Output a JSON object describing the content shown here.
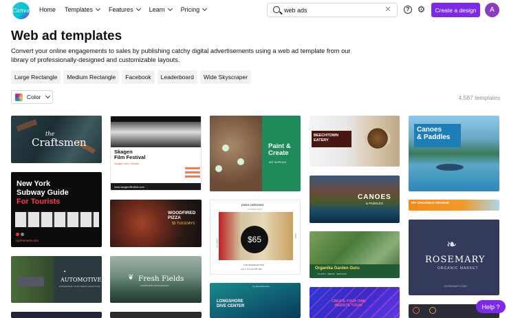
{
  "nav": {
    "logo_text": "Canva",
    "links": [
      "Home",
      "Templates",
      "Features",
      "Learn",
      "Pricing"
    ],
    "search_value": "web ads",
    "create_label": "Create a design",
    "avatar_initial": "A",
    "help_symbol": "?"
  },
  "header": {
    "title": "Web ad templates",
    "description": "Convert your online engagements to sales by publishing catchy digital advertisements using a web ad template from our library of professionally-designed and customizable layouts."
  },
  "chips": [
    "Large Rectangle",
    "Medium Rectangle",
    "Facebook",
    "Leaderboard",
    "Wide Skyscraper"
  ],
  "filter": {
    "color_label": "Color"
  },
  "template_count": "4,587 templates",
  "templates": {
    "craftsmen": {
      "line1": "the",
      "line2": "Craftsmen"
    },
    "skagen": {
      "title": "Skagen\nFilm Festival",
      "sub": "Skagen Arts Theatre",
      "url": "www.skagenfilmfest.com"
    },
    "paint": {
      "title": "Paint &\nCreate",
      "sub": "ART SUPPLIES"
    },
    "beechtown": {
      "title": "BEECHTOWN\nEATERY"
    },
    "canoes_paddles": {
      "title": "Canoes\n& Paddles"
    },
    "nyc": {
      "line1": "New York",
      "line2": "Subway Guide",
      "line3": "For Tourists",
      "url": "nycforevers.com"
    },
    "pizza": {
      "title": "WOODFIRED\nPIZZA",
      "sub": "$5 TUESDAYS"
    },
    "pasta": {
      "title": "pasta carbonara",
      "sub": "CLASSIC DISH",
      "price": "$65",
      "side1": "Mr. Italian",
      "side2": "Dolce",
      "foot1": "FOR RESERVATIONS",
      "foot2": "CALL 173 212 567 890"
    },
    "canoes": {
      "title": "CANOES",
      "sub": "& PADDLES"
    },
    "organico": {
      "title": "TRY ORGANICO ORANGE"
    },
    "rosemary": {
      "title": "ROSEMARY",
      "sub": "ORGANIC MARKET",
      "url": "ROSEMARY.COM"
    },
    "automotive": {
      "title": "AUTOMOTIVE",
      "sub": "EXPERIENCE YOUR DREAM ADVENTURE"
    },
    "fresh": {
      "title": "Fresh Fields",
      "sub": "LANDSCAPE PHOTOGRAPHY"
    },
    "longshore": {
      "title": "LONGSHORE\nDIVE CENTER",
      "sub": "Try dive adventure"
    },
    "garden": {
      "title": "Organika Garden Guru",
      "sub": "PLANTS · SEEDS · SERVICES"
    },
    "website": {
      "title": "CREATE YOUR OWN\nWEBSITE TODAY"
    }
  },
  "help_label": "Help ?",
  "colors": {
    "accent": "#7d2ae8",
    "chip_bg": "#f1f2f4"
  }
}
